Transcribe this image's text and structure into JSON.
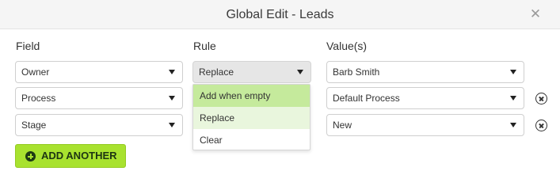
{
  "dialog": {
    "title": "Global Edit - Leads",
    "close_glyph": "✕"
  },
  "columns": {
    "field": "Field",
    "rule": "Rule",
    "values": "Value(s)"
  },
  "rows": [
    {
      "field": "Owner",
      "rule": "Replace",
      "value": "Barb Smith",
      "removable": false
    },
    {
      "field": "Process",
      "rule": "",
      "value": "Default Process",
      "removable": true
    },
    {
      "field": "Stage",
      "rule": "",
      "value": "New",
      "removable": true
    }
  ],
  "rule_dropdown": {
    "open": true,
    "options": [
      "Add when empty",
      "Replace",
      "Clear"
    ],
    "hovered": "Add when empty",
    "selected": "Replace"
  },
  "add_button": {
    "label": "ADD ANOTHER",
    "icon": "plus-circle-icon"
  },
  "colors": {
    "accent": "#a8e22f",
    "hover": "#c5ea9c",
    "selected": "#e9f6dd"
  }
}
